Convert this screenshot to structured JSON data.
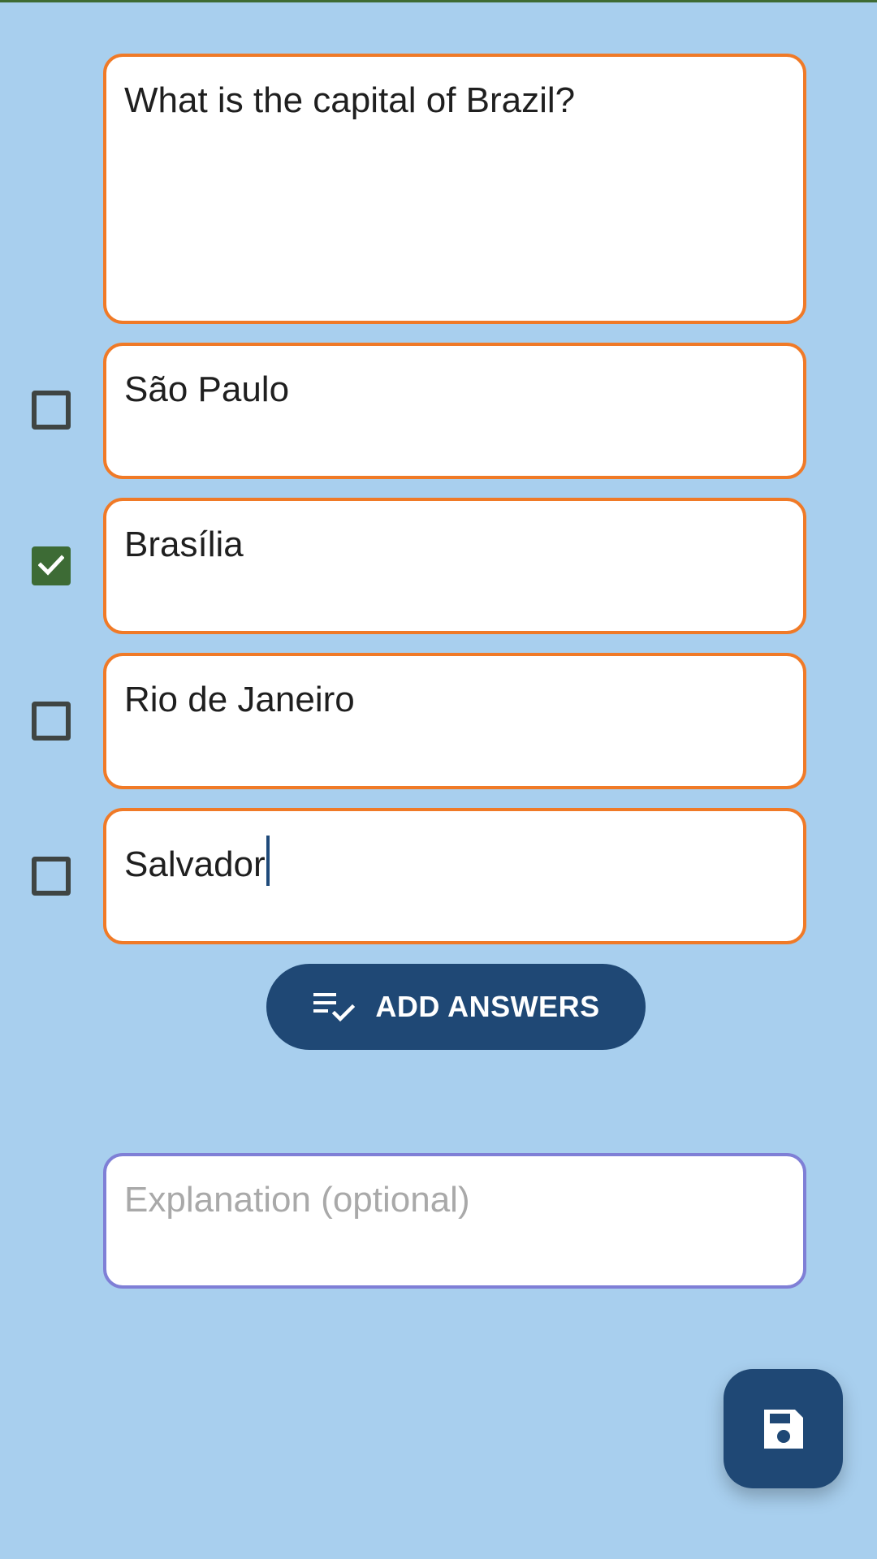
{
  "question": {
    "value": "What is the capital of Brazil?"
  },
  "answers": [
    {
      "value": "São Paulo",
      "checked": false
    },
    {
      "value": "Brasília",
      "checked": true
    },
    {
      "value": "Rio de Janeiro",
      "checked": false
    },
    {
      "value": "Salvador",
      "checked": false
    }
  ],
  "add_answers_button": {
    "label": "ADD ANSWERS",
    "icon": "checklist-icon"
  },
  "explanation": {
    "placeholder": "Explanation (optional)",
    "value": ""
  },
  "save_button": {
    "icon": "save-icon"
  },
  "colors": {
    "background": "#a8cfee",
    "field_border": "#f07a27",
    "explanation_border": "#7f7fd6",
    "primary": "#1f4875",
    "checkbox_checked": "#3d6b35"
  }
}
